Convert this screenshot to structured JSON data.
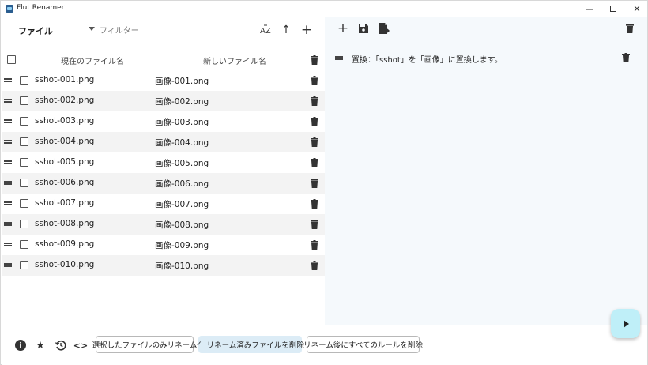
{
  "window": {
    "title": "Flut Renamer",
    "minimize_glyph": "—",
    "close_glyph": "✕"
  },
  "left": {
    "dropdown_label": "ファイル",
    "filter_placeholder": "フィルター",
    "sort_az": "AZ",
    "up_arrow": "↑",
    "add": "+",
    "header_current": "現在のファイル名",
    "header_new": "新しいファイル名",
    "files": [
      {
        "name": "sshot-001.png",
        "new_name": "画像-001.png"
      },
      {
        "name": "sshot-002.png",
        "new_name": "画像-002.png"
      },
      {
        "name": "sshot-003.png",
        "new_name": "画像-003.png"
      },
      {
        "name": "sshot-004.png",
        "new_name": "画像-004.png"
      },
      {
        "name": "sshot-005.png",
        "new_name": "画像-005.png"
      },
      {
        "name": "sshot-006.png",
        "new_name": "画像-006.png"
      },
      {
        "name": "sshot-007.png",
        "new_name": "画像-007.png"
      },
      {
        "name": "sshot-008.png",
        "new_name": "画像-008.png"
      },
      {
        "name": "sshot-009.png",
        "new_name": "画像-009.png"
      },
      {
        "name": "sshot-010.png",
        "new_name": "画像-010.png"
      }
    ]
  },
  "right": {
    "add": "+",
    "rule_text": "置換：「sshot」を「画像」に置換します。"
  },
  "bottom": {
    "info_icon": "i",
    "star_icon": "★",
    "history_icon": "⟲",
    "code_icon": "<>",
    "chip_selected_only": "選択したファイルのみリネーム",
    "chip_remove_renamed": "リネーム済みファイルを削除",
    "chip_remove_renamed_check": "✓",
    "chip_remove_rules": "リネーム後にすべてのルールを削除"
  },
  "colors": {
    "accent_fab": "#bfeff8",
    "selected_chip": "#dcecf6",
    "right_pane_bg": "#f5f9fc"
  }
}
